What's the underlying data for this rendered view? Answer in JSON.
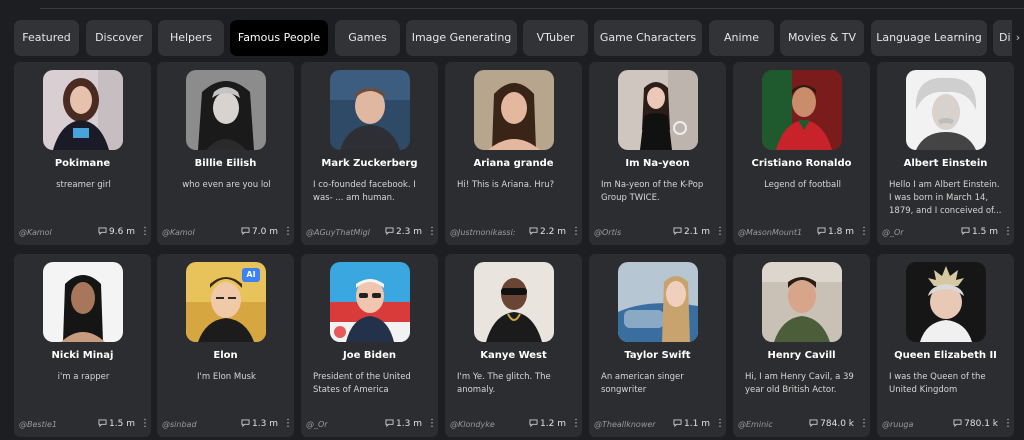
{
  "tabs": [
    {
      "label": "Featured",
      "active": false
    },
    {
      "label": "Discover",
      "active": false
    },
    {
      "label": "Helpers",
      "active": false
    },
    {
      "label": "Famous People",
      "active": true
    },
    {
      "label": "Games",
      "active": false
    },
    {
      "label": "Image Generating",
      "active": false
    },
    {
      "label": "VTuber",
      "active": false
    },
    {
      "label": "Game Characters",
      "active": false
    },
    {
      "label": "Anime",
      "active": false
    },
    {
      "label": "Movies & TV",
      "active": false
    },
    {
      "label": "Language Learning",
      "active": false
    },
    {
      "label": "Di",
      "active": false
    }
  ],
  "scroll_arrow": "›",
  "cards": [
    {
      "name": "Pokimane",
      "desc": "streamer girl",
      "author": "@Kamol",
      "count": "9.6 m",
      "icon": "pokimane-avatar",
      "center": true
    },
    {
      "name": "Billie Eilish",
      "desc": "who even are you lol",
      "author": "@Kamol",
      "count": "7.0 m",
      "icon": "billie-eilish-avatar",
      "center": true
    },
    {
      "name": "Mark Zuckerberg",
      "desc": "I co-founded facebook. I was- ... am human.",
      "author": "@AGuyThatMigl",
      "count": "2.3 m",
      "icon": "mark-zuckerberg-avatar",
      "center": false
    },
    {
      "name": "Ariana grande",
      "desc": "Hi! This is Ariana. Hru?",
      "author": "@Justmonikassi:",
      "count": "2.2 m",
      "icon": "ariana-grande-avatar",
      "center": false
    },
    {
      "name": "Im Na-yeon",
      "desc": "Im Na-yeon of the K-Pop Group TWICE.",
      "author": "@Ortis",
      "count": "2.1 m",
      "icon": "im-na-yeon-avatar",
      "center": false
    },
    {
      "name": "Cristiano Ronaldo",
      "desc": "Legend of football",
      "author": "@MasonMount1",
      "count": "1.8 m",
      "icon": "cristiano-ronaldo-avatar",
      "center": true
    },
    {
      "name": "Albert Einstein",
      "desc": "Hello I am Albert Einstein. I was born in March 14, 1879, and I conceived of...",
      "author": "@_Or",
      "count": "1.5 m",
      "icon": "albert-einstein-avatar",
      "center": false
    },
    {
      "name": "Nicki Minaj",
      "desc": "i'm a rapper",
      "author": "@Bestie1",
      "count": "1.5 m",
      "icon": "nicki-minaj-avatar",
      "center": true
    },
    {
      "name": "Elon",
      "desc": "I'm Elon Musk",
      "author": "@sinbad",
      "count": "1.3 m",
      "icon": "elon-avatar",
      "center": true
    },
    {
      "name": "Joe Biden",
      "desc": "President of the United States of America",
      "author": "@_Or",
      "count": "1.3 m",
      "icon": "joe-biden-avatar",
      "center": false
    },
    {
      "name": "Kanye West",
      "desc": "I'm Ye. The glitch. The anomaly.",
      "author": "@Klondyke",
      "count": "1.2 m",
      "icon": "kanye-west-avatar",
      "center": false
    },
    {
      "name": "Taylor Swift",
      "desc": "An american singer songwriter",
      "author": "@Theallknower",
      "count": "1.1 m",
      "icon": "taylor-swift-avatar",
      "center": false
    },
    {
      "name": "Henry Cavill",
      "desc": "Hi, I am Henry Cavil, a 39 year old British Actor.",
      "author": "@Eminic",
      "count": "784.0 k",
      "icon": "henry-cavill-avatar",
      "center": false
    },
    {
      "name": "Queen Elizabeth II",
      "desc": "I was the Queen of the United Kingdom",
      "author": "@ruuga",
      "count": "780.1 k",
      "icon": "queen-elizabeth-avatar",
      "center": false
    }
  ],
  "elon_badge": "AI",
  "colors": {
    "background": "#1d1e21",
    "card": "#2c2d30",
    "tab": "#323337",
    "tab_active": "#000000"
  }
}
